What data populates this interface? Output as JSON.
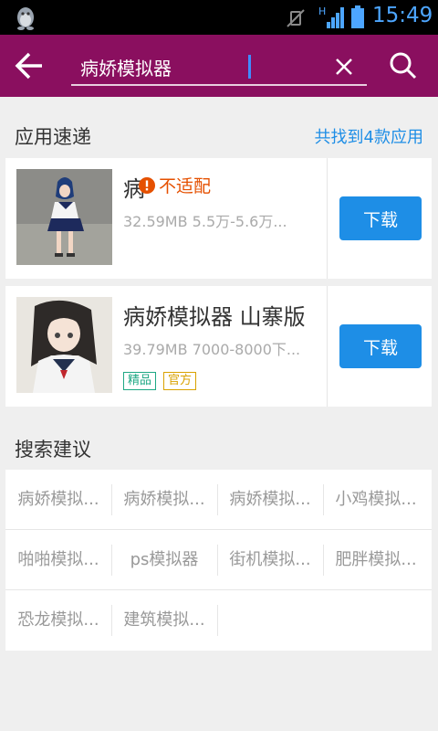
{
  "status_bar": {
    "time": "15:49",
    "network": "H"
  },
  "header": {
    "search_value": "病娇模拟器",
    "back_icon": "arrow-left-icon",
    "clear_icon": "close-icon",
    "search_icon": "search-icon"
  },
  "quick_apps": {
    "title": "应用速递",
    "count_text": "共找到4款应用",
    "apps": [
      {
        "name": "病",
        "warning": "不适配",
        "meta": "32.59MB  5.5万-5.6万...",
        "download_label": "下载"
      },
      {
        "name": "病娇模拟器 山寨版",
        "meta": "39.79MB  7000-8000下...",
        "download_label": "下载",
        "tags": [
          "精品",
          "官方"
        ]
      }
    ]
  },
  "suggestions": {
    "title": "搜索建议",
    "items": [
      "病娇模拟...",
      "病娇模拟...",
      "病娇模拟...",
      "小鸡模拟...",
      "啪啪模拟...",
      "ps模拟器",
      "街机模拟...",
      "肥胖模拟...",
      "恐龙模拟...",
      "建筑模拟..."
    ]
  },
  "colors": {
    "header_bg": "#8a0f5f",
    "accent": "#1e8ee6",
    "warning": "#e55000",
    "tag_featured": "#1ea884",
    "tag_official": "#d9a200"
  }
}
